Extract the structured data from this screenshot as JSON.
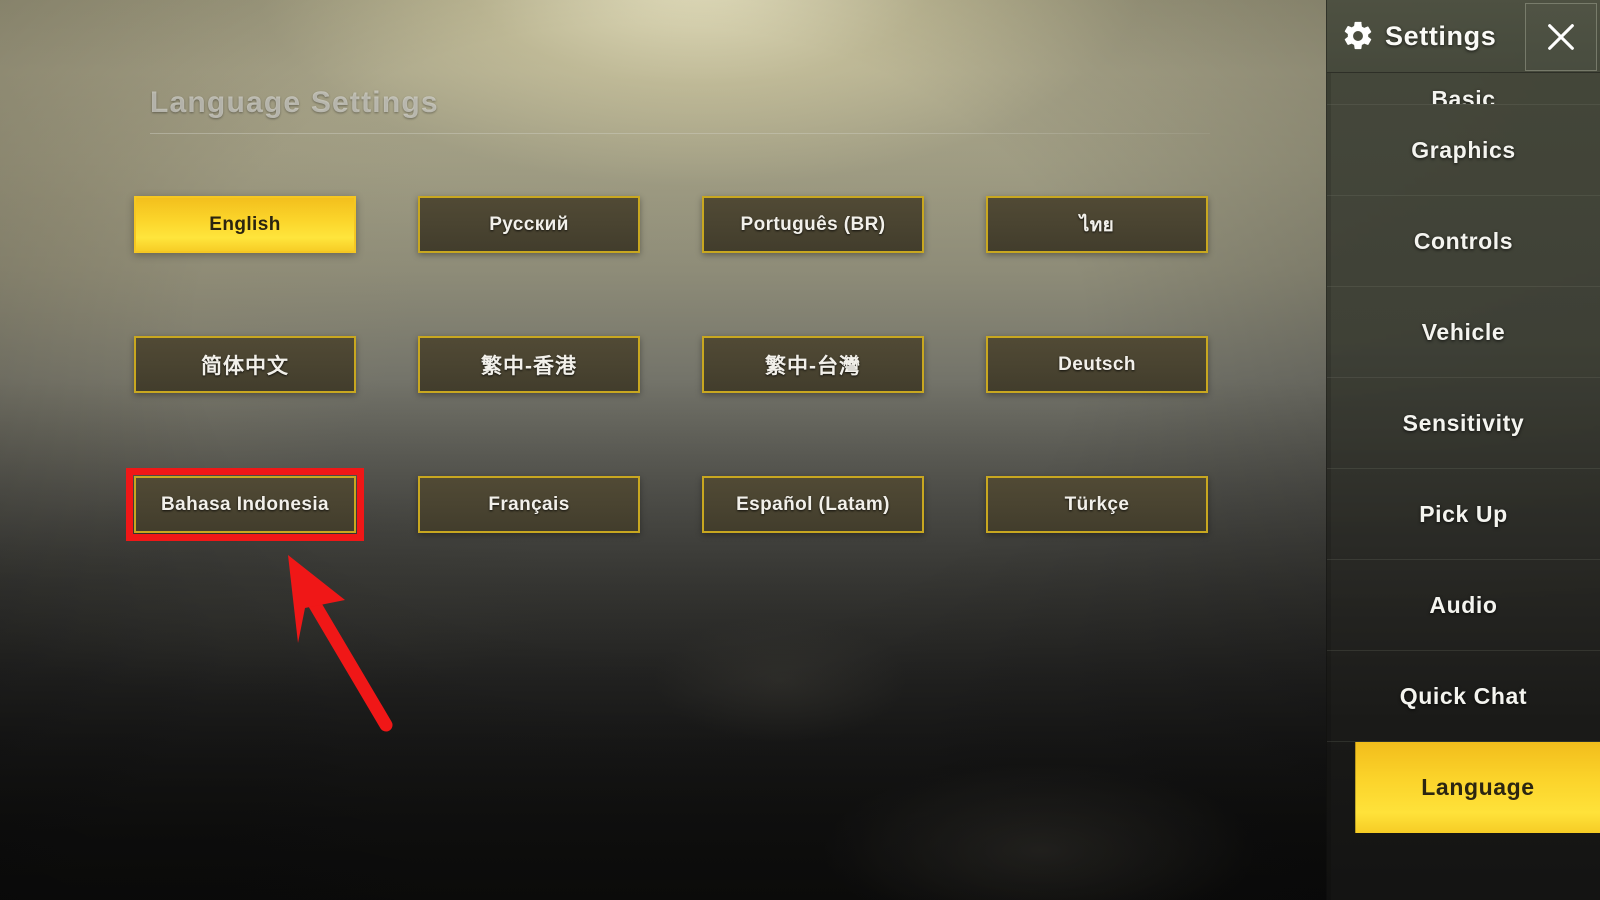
{
  "page": {
    "title": "Language Settings"
  },
  "languages": [
    {
      "label": "English",
      "selected": true,
      "annotated": false,
      "cjk": false
    },
    {
      "label": "Русский",
      "selected": false,
      "annotated": false,
      "cjk": false
    },
    {
      "label": "Português (BR)",
      "selected": false,
      "annotated": false,
      "cjk": false
    },
    {
      "label": "ไทย",
      "selected": false,
      "annotated": false,
      "cjk": false
    },
    {
      "label": "简体中文",
      "selected": false,
      "annotated": false,
      "cjk": true
    },
    {
      "label": "繁中-香港",
      "selected": false,
      "annotated": false,
      "cjk": true
    },
    {
      "label": "繁中-台灣",
      "selected": false,
      "annotated": false,
      "cjk": true
    },
    {
      "label": "Deutsch",
      "selected": false,
      "annotated": false,
      "cjk": false
    },
    {
      "label": "Bahasa Indonesia",
      "selected": false,
      "annotated": true,
      "cjk": false
    },
    {
      "label": "Français",
      "selected": false,
      "annotated": false,
      "cjk": false
    },
    {
      "label": "Español (Latam)",
      "selected": false,
      "annotated": false,
      "cjk": false
    },
    {
      "label": "Türkçe",
      "selected": false,
      "annotated": false,
      "cjk": false
    }
  ],
  "panel": {
    "title": "Settings",
    "gear_icon": "gear-icon",
    "close_icon": "close-icon",
    "items": [
      {
        "label": "Basic",
        "active": false,
        "partial": true
      },
      {
        "label": "Graphics",
        "active": false,
        "partial": false
      },
      {
        "label": "Controls",
        "active": false,
        "partial": false
      },
      {
        "label": "Vehicle",
        "active": false,
        "partial": false
      },
      {
        "label": "Sensitivity",
        "active": false,
        "partial": false
      },
      {
        "label": "Pick Up",
        "active": false,
        "partial": false
      },
      {
        "label": "Audio",
        "active": false,
        "partial": false
      },
      {
        "label": "Quick Chat",
        "active": false,
        "partial": false
      },
      {
        "label": "Language",
        "active": true,
        "partial": false
      }
    ]
  },
  "annotation": {
    "arrow_icon": "arrow-up-left-icon",
    "highlight_color": "#f01717",
    "arrow_color": "#f01717",
    "target": "Bahasa Indonesia"
  },
  "colors": {
    "accent_yellow": "#ffe23a",
    "accent_yellow_dark": "#f2bd1c",
    "button_border": "#c8a720",
    "button_fill": "#4a4431",
    "annotation_red": "#f01717",
    "panel_bg": "#3c3e34",
    "text_light": "#f4f4ef"
  }
}
